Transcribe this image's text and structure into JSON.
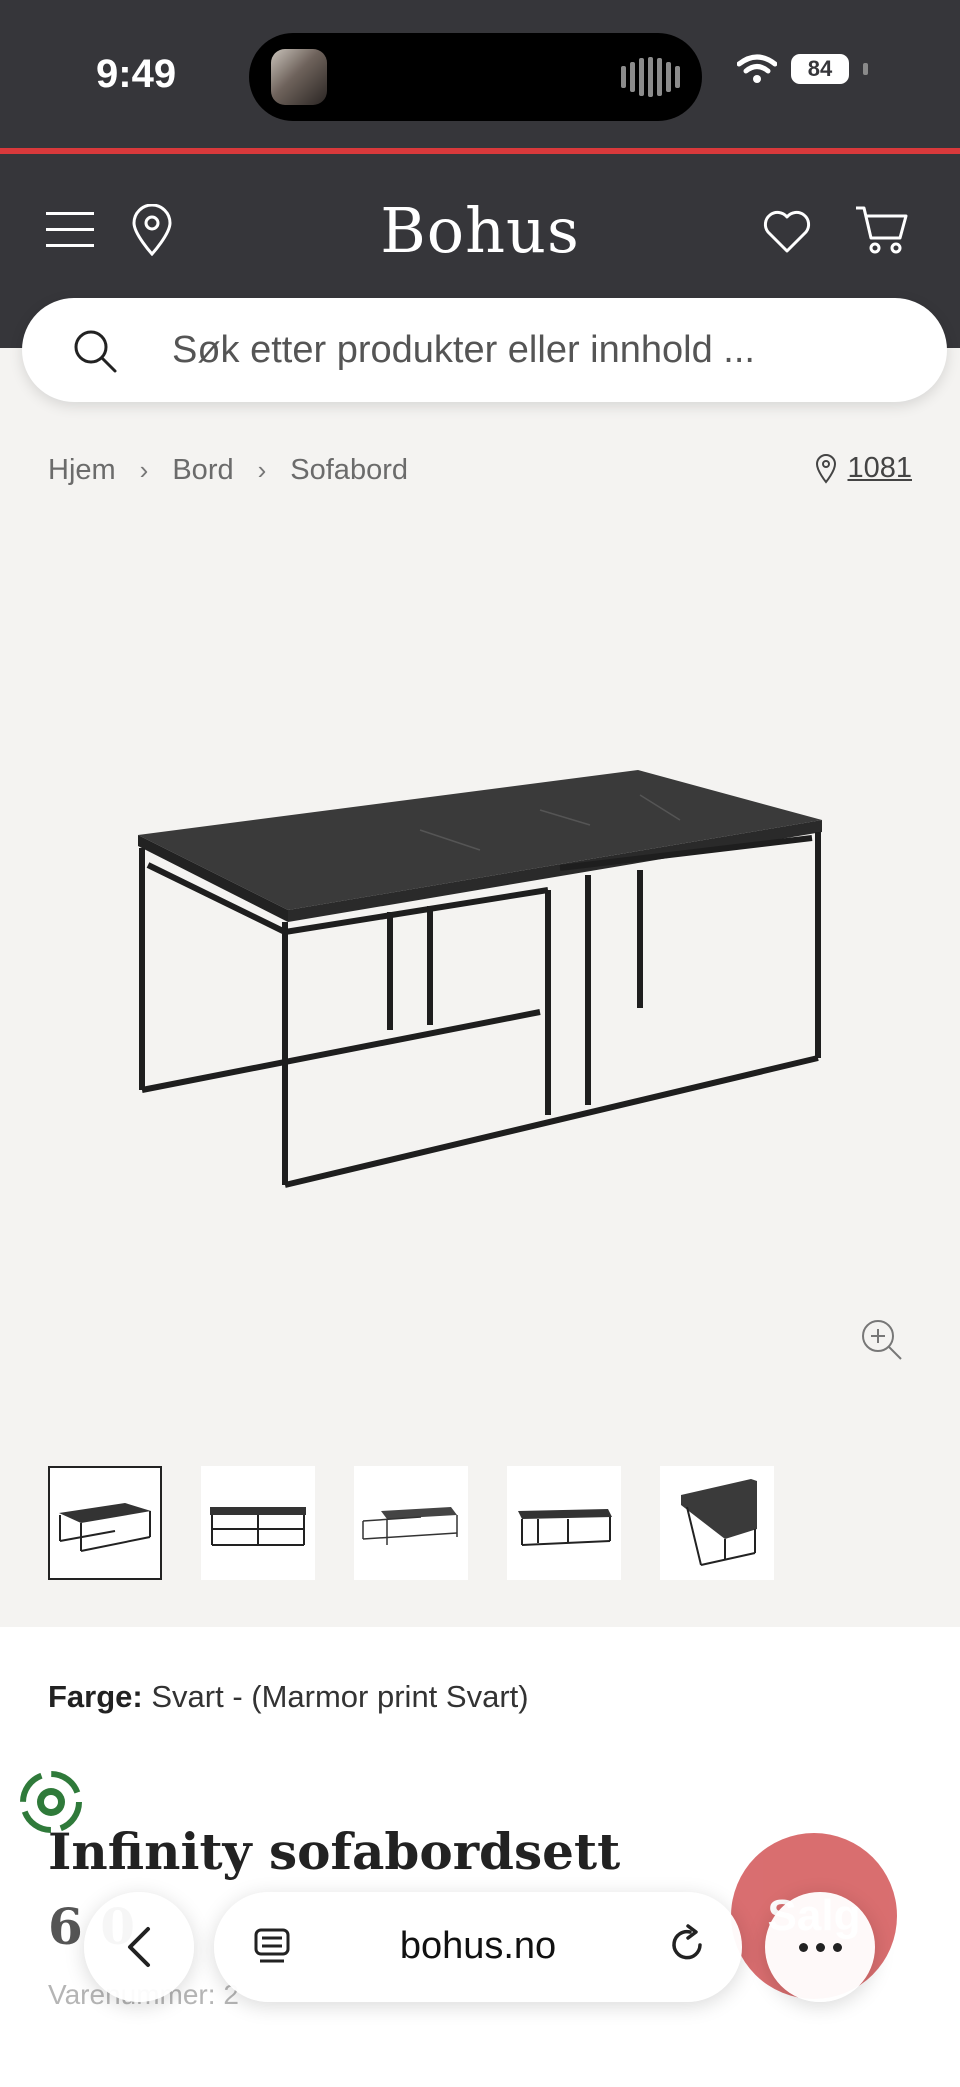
{
  "status_bar": {
    "time": "9:49",
    "battery": "84"
  },
  "header": {
    "logo": "Bohus",
    "icons": [
      "menu-icon",
      "location-pin-icon",
      "heart-icon",
      "cart-icon"
    ],
    "accent_color": "#d9393b",
    "bg_color": "#36363a"
  },
  "search": {
    "placeholder": "Søk etter produkter eller innhold ..."
  },
  "breadcrumb": {
    "items": [
      "Hjem",
      "Bord",
      "Sofabord"
    ],
    "zip": "1081"
  },
  "gallery": {
    "thumb_count": 5,
    "active_thumb": 1
  },
  "product": {
    "color_label": "Farge:",
    "color_value": "Svart - (Marmor print Svart)",
    "title": "Infinity sofabordsett",
    "price": "6 0",
    "article_label": "Varenummer: 2",
    "sale_badge": "Salg"
  },
  "browser": {
    "url": "bohus.no"
  }
}
